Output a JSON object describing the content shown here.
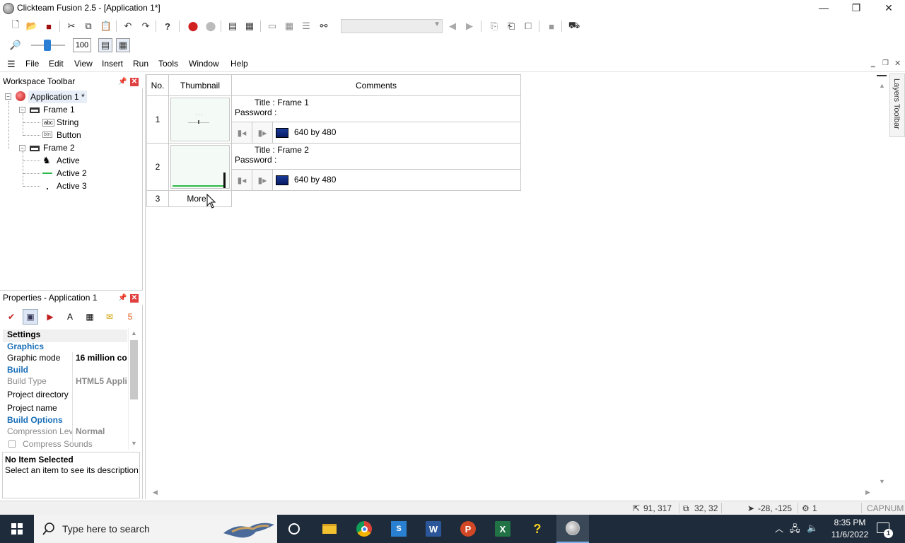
{
  "window": {
    "title": "Clickteam Fusion 2.5 - [Application 1*]",
    "minimize": "—",
    "restore": "❐",
    "close": "✕"
  },
  "toolbar2": {
    "zoom_value": "100"
  },
  "menu": [
    "File",
    "Edit",
    "View",
    "Insert",
    "Run",
    "Tools",
    "Window",
    "Help"
  ],
  "workspace": {
    "title": "Workspace Toolbar",
    "tree": {
      "app": "Application 1 *",
      "frame1": "Frame 1",
      "frame1_items": [
        "String",
        "Button"
      ],
      "frame2": "Frame 2",
      "frame2_items": [
        "Active",
        "Active 2",
        "Active 3"
      ]
    }
  },
  "properties": {
    "title": "Properties - Application 1",
    "rows": [
      {
        "label": "Settings",
        "kind": "header"
      },
      {
        "label": "Graphics",
        "kind": "cat"
      },
      {
        "label": "Graphic mode",
        "value": "16 million co",
        "kind": "row"
      },
      {
        "label": "Build",
        "kind": "cat"
      },
      {
        "label": "Build Type",
        "value": "HTML5 Appli",
        "kind": "disabled"
      },
      {
        "label": "Project directory",
        "value": "",
        "kind": "row"
      },
      {
        "label": "Project name",
        "value": "",
        "kind": "row"
      },
      {
        "label": "Build Options",
        "kind": "cat"
      },
      {
        "label": "Compression Lev",
        "value": "Normal",
        "kind": "disabled"
      },
      {
        "label": "Compress Sounds",
        "kind": "check"
      }
    ],
    "desc_title": "No Item Selected",
    "desc_text": "Select an item to see its description"
  },
  "storyboard": {
    "headers": {
      "no": "No.",
      "thumb": "Thumbnail",
      "comments": "Comments"
    },
    "frames": [
      {
        "no": "1",
        "title_label": "Title :",
        "title": "Frame 1",
        "password_label": "Password :",
        "size": "640  by 480"
      },
      {
        "no": "2",
        "title_label": "Title :",
        "title": "Frame 2",
        "password_label": "Password :",
        "size": "640  by 480"
      }
    ],
    "more_no": "3",
    "more_label": "More..."
  },
  "layers_label": "Layers Toolbar",
  "status": {
    "coords": "91, 317",
    "size": "32, 32",
    "offset": "-28, -125",
    "layer": "1",
    "cap": "CAP",
    "num": "NUM"
  },
  "taskbar": {
    "search_placeholder": "Type here to search",
    "time": "8:35 PM",
    "date": "11/6/2022",
    "notif_count": "1"
  },
  "colors": {
    "accent_blue": "#1a6fb8",
    "close_red": "#e04040",
    "taskbar_bg": "#1e2b3a"
  }
}
